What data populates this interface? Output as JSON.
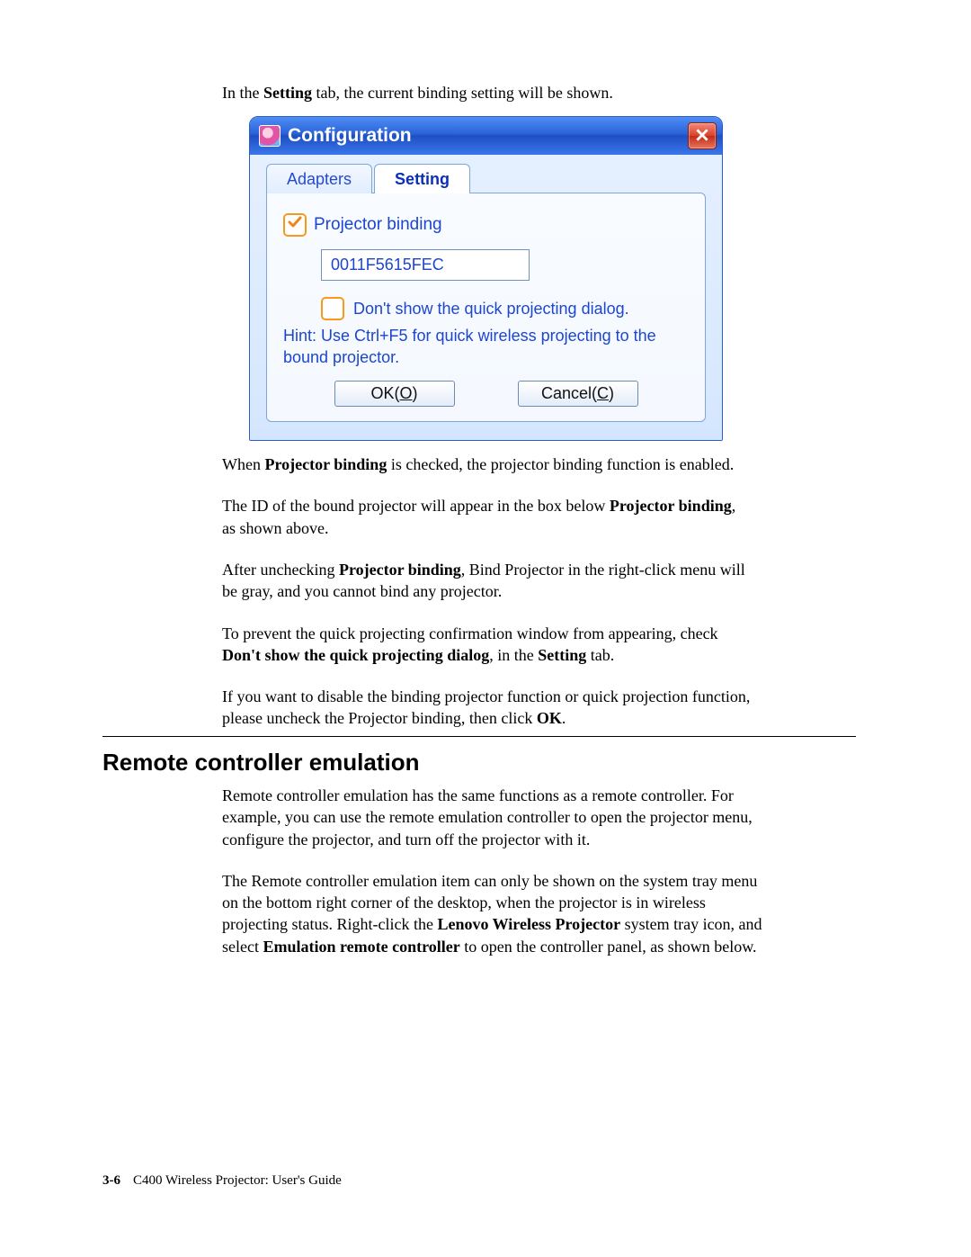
{
  "intro": {
    "prefix": "In the ",
    "bold1": "Setting",
    "rest": " tab, the current binding setting will be shown."
  },
  "dialog": {
    "title": "Configuration",
    "tabs": {
      "inactive": "Adapters",
      "active": "Setting"
    },
    "projector_binding_label": "Projector binding",
    "bound_id": "0011F5615FEC",
    "dont_show_label": "Don't show the quick projecting dialog.",
    "hint": "Hint: Use Ctrl+F5 for quick wireless projecting  to the bound projector.",
    "ok_prefix": "OK(",
    "ok_u": "O",
    "ok_suffix": ")",
    "cancel_prefix": "Cancel(",
    "cancel_u": "C",
    "cancel_suffix": ")"
  },
  "p2": {
    "a": "When ",
    "b": "Projector binding",
    "c": " is checked, the projector binding function is enabled."
  },
  "p3": {
    "a": "The ID of the bound projector will appear in the box below ",
    "b": "Projector binding",
    "c": ", as shown above."
  },
  "p4": {
    "a": "After unchecking ",
    "b": "Projector binding",
    "c": ", Bind Projector in the right-click menu will be gray, and you cannot bind any projector."
  },
  "p5": {
    "a": "To prevent the quick projecting confirmation window from appearing, check ",
    "b": "Don't show the quick projecting dialog",
    "c": ", in the ",
    "d": "Setting",
    "e": " tab."
  },
  "p6": {
    "a": "If you want to disable the binding projector function or quick projection function, please uncheck the Projector binding, then click ",
    "b": "OK",
    "c": "."
  },
  "section_heading": "Remote controller emulation",
  "p7": "Remote controller emulation has the same functions as a remote controller. For example, you can use the remote emulation controller to open the projector menu, configure the projector, and turn off the projector with it.",
  "p8": {
    "a": "The Remote controller emulation item can only be shown on the system tray menu on the bottom right corner of the desktop, when the projector is in wireless projecting status. Right-click the ",
    "b": "Lenovo Wireless Projector",
    "c": " system tray icon, and select ",
    "d": "Emulation remote controller",
    "e": " to open the controller panel, as shown below."
  },
  "footer": {
    "page": "3-6",
    "title": "C400 Wireless Projector: User's Guide"
  }
}
